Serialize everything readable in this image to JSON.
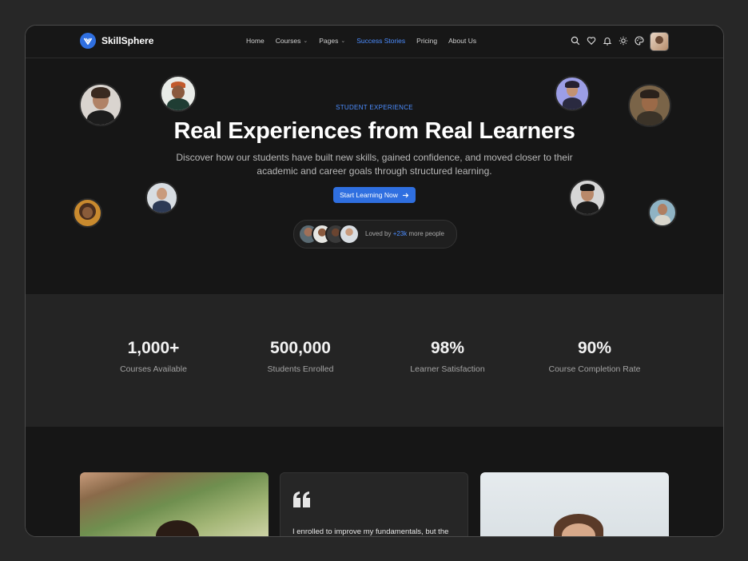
{
  "brand": {
    "name": "SkillSphere",
    "accent": "#2f6fe0"
  },
  "nav": {
    "items": [
      {
        "label": "Home"
      },
      {
        "label": "Courses",
        "has_dropdown": true
      },
      {
        "label": "Pages",
        "has_dropdown": true
      },
      {
        "label": "Success Stories",
        "active": true
      },
      {
        "label": "Pricing"
      },
      {
        "label": "About Us"
      }
    ],
    "icons": [
      "search-icon",
      "heart-icon",
      "bell-icon",
      "sun-icon",
      "palette-icon"
    ]
  },
  "hero": {
    "eyebrow": "STUDENT EXPERIENCE",
    "title": "Real Experiences from Real Learners",
    "subtitle": "Discover how our students have built new skills, gained confidence, and moved closer to their academic and career goals through structured learning.",
    "cta_label": "Start Learning Now",
    "loved_prefix": "Loved by",
    "loved_count": "+23k",
    "loved_suffix": "more people"
  },
  "stats": [
    {
      "value": "1,000+",
      "label": "Courses Available"
    },
    {
      "value": "500,000",
      "label": "Students Enrolled"
    },
    {
      "value": "98%",
      "label": "Learner Satisfaction"
    },
    {
      "value": "90%",
      "label": "Course Completion Rate"
    }
  ],
  "testimonials": {
    "quote_snippet": "I enrolled to improve my fundamentals, but the"
  }
}
